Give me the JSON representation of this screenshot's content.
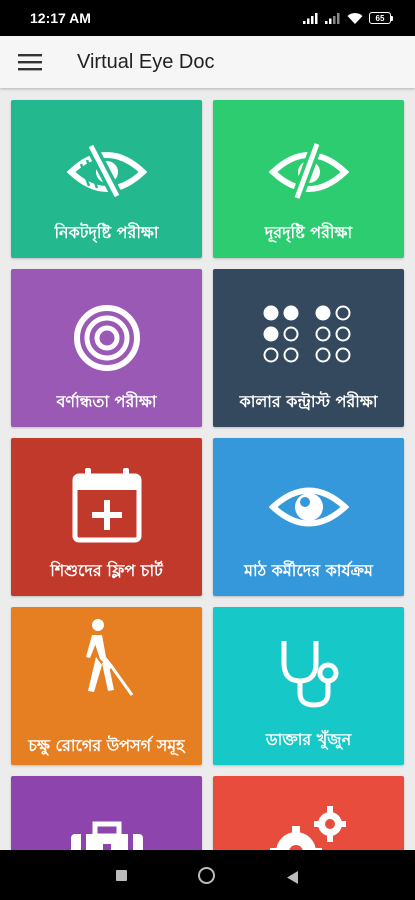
{
  "status": {
    "time": "12:17 AM",
    "battery": "65"
  },
  "app": {
    "title": "Virtual Eye Doc"
  },
  "colors": {
    "near_vision": "#24b88f",
    "distance_vision": "#2ecc71",
    "color_blindness": "#9b59b6",
    "color_contrast": "#34495e",
    "kids_flip_chart": "#c0392b",
    "field_worker": "#3498db",
    "eye_symptoms": "#e67e22",
    "find_doctor": "#16c8c8",
    "first_aid": "#8e44ad",
    "settings": "#e74c3c"
  },
  "tiles": [
    {
      "label": "নিকটদৃষ্টি পরীক্ষা",
      "icon": "eye-slash-icon"
    },
    {
      "label": "দূরদৃষ্টি পরীক্ষা",
      "icon": "eye-slash-icon"
    },
    {
      "label": "বর্ণান্ধতা পরীক্ষা",
      "icon": "target-icon"
    },
    {
      "label": "কালার কন্ট্রাস্ট পরীক্ষা",
      "icon": "dots-grid-icon"
    },
    {
      "label": "শিশুদের ফ্লিপ চার্ট",
      "icon": "calendar-plus-icon"
    },
    {
      "label": "মাঠ কর্মীদের কার্যক্রম",
      "icon": "eye-icon"
    },
    {
      "label": "চক্ষু রোগের উপসর্গ সমূহ",
      "icon": "blind-walker-icon"
    },
    {
      "label": "ডাক্তার খুঁজুন",
      "icon": "stethoscope-icon"
    },
    {
      "label": "",
      "icon": "medkit-icon"
    },
    {
      "label": "",
      "icon": "gears-icon"
    }
  ]
}
